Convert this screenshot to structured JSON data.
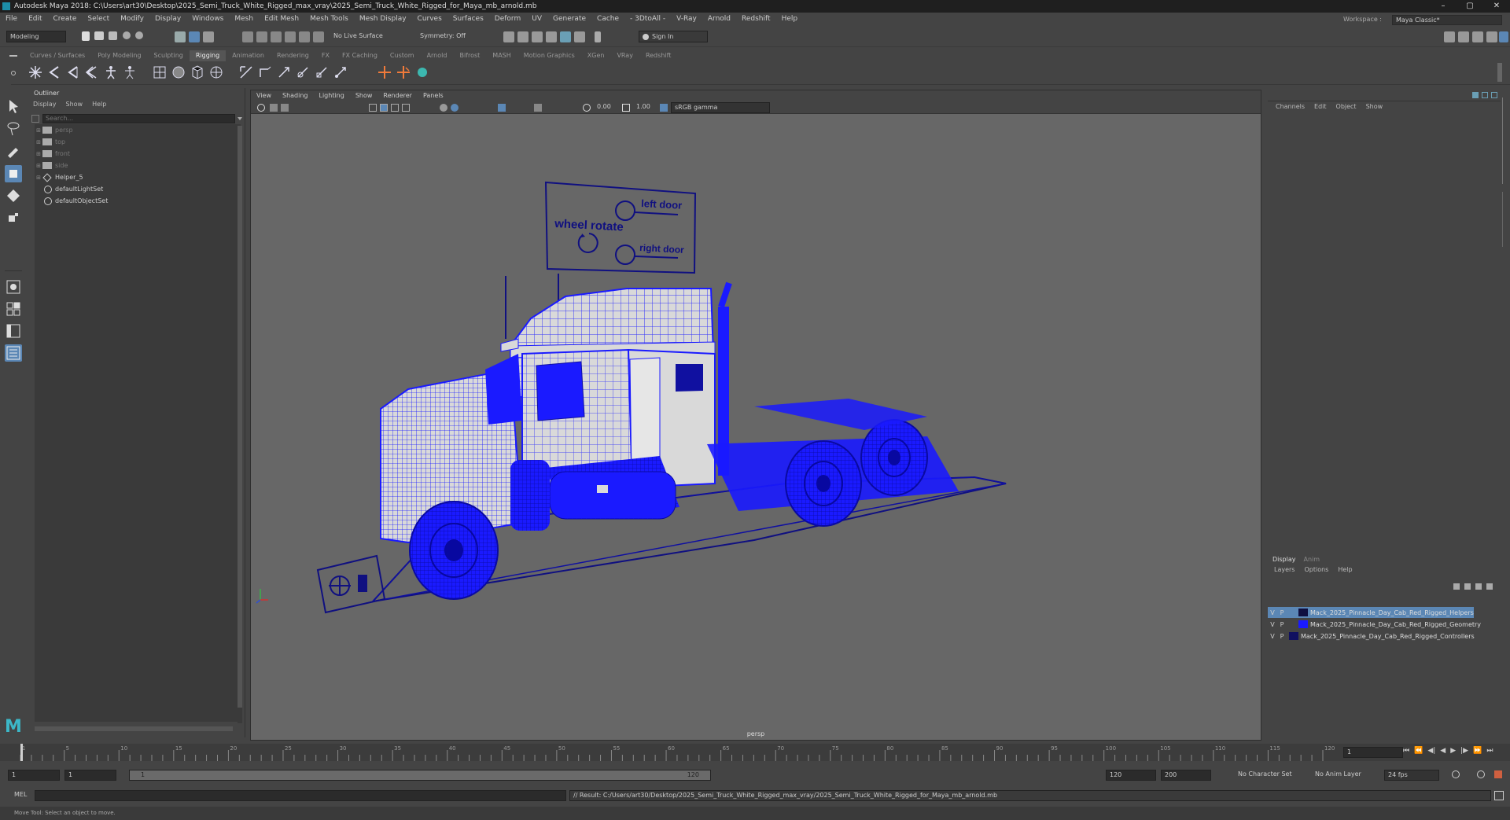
{
  "app": {
    "title": "Autodesk Maya 2018: C:\\Users\\art30\\Desktop\\2025_Semi_Truck_White_Rigged_max_vray\\2025_Semi_Truck_White_Rigged_for_Maya_mb_arnold.mb",
    "window_controls": [
      "–",
      "▢",
      "✕"
    ]
  },
  "menubar": {
    "items": [
      "File",
      "Edit",
      "Create",
      "Select",
      "Modify",
      "Display",
      "Windows",
      "Mesh",
      "Edit Mesh",
      "Mesh Tools",
      "Mesh Display",
      "Curves",
      "Surfaces",
      "Deform",
      "UV",
      "Generate",
      "Cache",
      "- 3DtoAll -",
      "V-Ray",
      "Arnold",
      "Redshift",
      "Help"
    ],
    "workspace_label": "Workspace :",
    "workspace_value": "Maya Classic*"
  },
  "statusline": {
    "mode": "Modeling",
    "live_surface": "No Live Surface",
    "symmetry": "Symmetry: Off",
    "sign_in": "Sign In"
  },
  "shelf": {
    "tabs": [
      "Curves / Surfaces",
      "Poly Modeling",
      "Sculpting",
      "Rigging",
      "Animation",
      "Rendering",
      "FX",
      "FX Caching",
      "Custom",
      "Arnold",
      "Bifrost",
      "MASH",
      "Motion Graphics",
      "XGen",
      "VRay",
      "Redshift"
    ],
    "active_tab": "Rigging"
  },
  "outliner": {
    "title": "Outliner",
    "menu": [
      "Display",
      "Show",
      "Help"
    ],
    "search_placeholder": "Search...",
    "items": [
      {
        "label": "persp",
        "type": "camera",
        "dim": true
      },
      {
        "label": "top",
        "type": "camera",
        "dim": true
      },
      {
        "label": "front",
        "type": "camera",
        "dim": true
      },
      {
        "label": "side",
        "type": "camera",
        "dim": true
      },
      {
        "label": "Helper_5",
        "type": "transform",
        "dim": false
      },
      {
        "label": "defaultLightSet",
        "type": "set",
        "dim": false
      },
      {
        "label": "defaultObjectSet",
        "type": "set",
        "dim": false
      }
    ]
  },
  "viewport": {
    "menu": [
      "View",
      "Shading",
      "Lighting",
      "Show",
      "Renderer",
      "Panels"
    ],
    "exposure": "0.00",
    "gamma": "1.00",
    "color_space": "sRGB gamma",
    "camera_label": "persp",
    "control_board": {
      "wheel_rotate": "wheel rotate",
      "left_door": "left door",
      "right_door": "right door"
    },
    "wire_color": "#1a1aff",
    "bg_color": "#676767"
  },
  "channelbox": {
    "menu": [
      "Channels",
      "Edit",
      "Object",
      "Show"
    ]
  },
  "layers": {
    "tabs": [
      "Display",
      "Anim"
    ],
    "menu": [
      "Layers",
      "Options",
      "Help"
    ],
    "rows": [
      {
        "v": "V",
        "p": "P",
        "name": "Mack_2025_Pinnacle_Day_Cab_Red_Rigged_Helpers",
        "color": "#101040",
        "selected": true
      },
      {
        "v": "V",
        "p": "P",
        "name": "Mack_2025_Pinnacle_Day_Cab_Red_Rigged_Geometry",
        "color": "#1a1aff",
        "selected": false
      },
      {
        "v": "V",
        "p": "P",
        "name": "Mack_2025_Pinnacle_Day_Cab_Red_Rigged_Controllers",
        "color": "#101060",
        "selected": false
      }
    ]
  },
  "timeslider": {
    "ticks": [
      "1",
      "5",
      "10",
      "15",
      "20",
      "25",
      "30",
      "35",
      "40",
      "45",
      "50",
      "55",
      "60",
      "65",
      "70",
      "75",
      "80",
      "85",
      "90",
      "95",
      "100",
      "105",
      "110",
      "115",
      "120"
    ],
    "current_frame": "1"
  },
  "rangeslider": {
    "start": "1",
    "anim_start": "1",
    "range_start_field": "1",
    "range_end_label": "120",
    "end": "120",
    "anim_end": "200",
    "character_set": "No Character Set",
    "anim_layer": "No Anim Layer",
    "fps": "24 fps"
  },
  "cmdline": {
    "language": "MEL",
    "result": "// Result: C:/Users/art30/Desktop/2025_Semi_Truck_White_Rigged_max_vray/2025_Semi_Truck_White_Rigged_for_Maya_mb_arnold.mb"
  },
  "helpline": {
    "text": "Move Tool: Select an object to move."
  }
}
